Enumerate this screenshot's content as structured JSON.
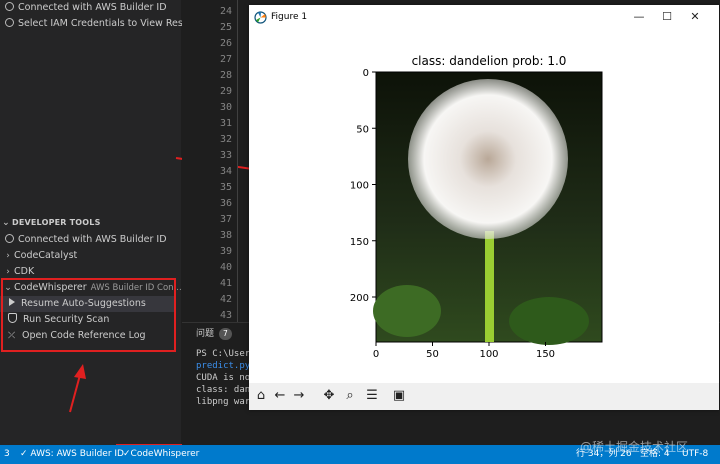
{
  "sidebar": {
    "top_items": [
      {
        "label": "Connected with AWS Builder ID"
      },
      {
        "label": "Select IAM Credentials to View Res..."
      }
    ],
    "developer_tools": {
      "title": "DEVELOPER TOOLS",
      "connected": "Connected with AWS Builder ID",
      "codecatalyst": "CodeCatalyst",
      "cdk": "CDK",
      "codewhisperer": "CodeWhisperer",
      "codewhisperer_sub": "AWS Builder ID Con...",
      "actions": [
        {
          "label": "Resume Auto-Suggestions"
        },
        {
          "label": "Run Security Scan"
        },
        {
          "label": "Open Code Reference Log"
        }
      ]
    }
  },
  "editor": {
    "line_numbers": [
      "24",
      "25",
      "26",
      "27",
      "28",
      "29",
      "30",
      "31",
      "32",
      "33",
      "34",
      "35",
      "36",
      "37",
      "38",
      "39",
      "40",
      "41",
      "42",
      "43"
    ]
  },
  "terminal": {
    "tab_label": "问题",
    "problem_count": "7",
    "lines": [
      "PS C:\\User",
      "predict.py",
      "CUDA is no",
      "class: dan",
      "libpng war"
    ]
  },
  "figure": {
    "window_title": "Figure 1",
    "plot_title": "class: dandelion   prob: 1.0",
    "x_ticks": [
      "0",
      "50",
      "100",
      "150"
    ],
    "y_ticks": [
      "0",
      "50",
      "100",
      "150",
      "200"
    ],
    "colors": {
      "flower_stem": "#9acd32",
      "background": "#1a2a12"
    }
  },
  "statusbar": {
    "left_num": "3",
    "aws_label": "AWS: AWS Builder ID",
    "codewhisperer_label": "CodeWhisperer",
    "cursor": "行 34，列 26",
    "spaces": "空格: 4",
    "encoding": "UTF-8"
  },
  "watermark": "@稀土掘金技术社区"
}
